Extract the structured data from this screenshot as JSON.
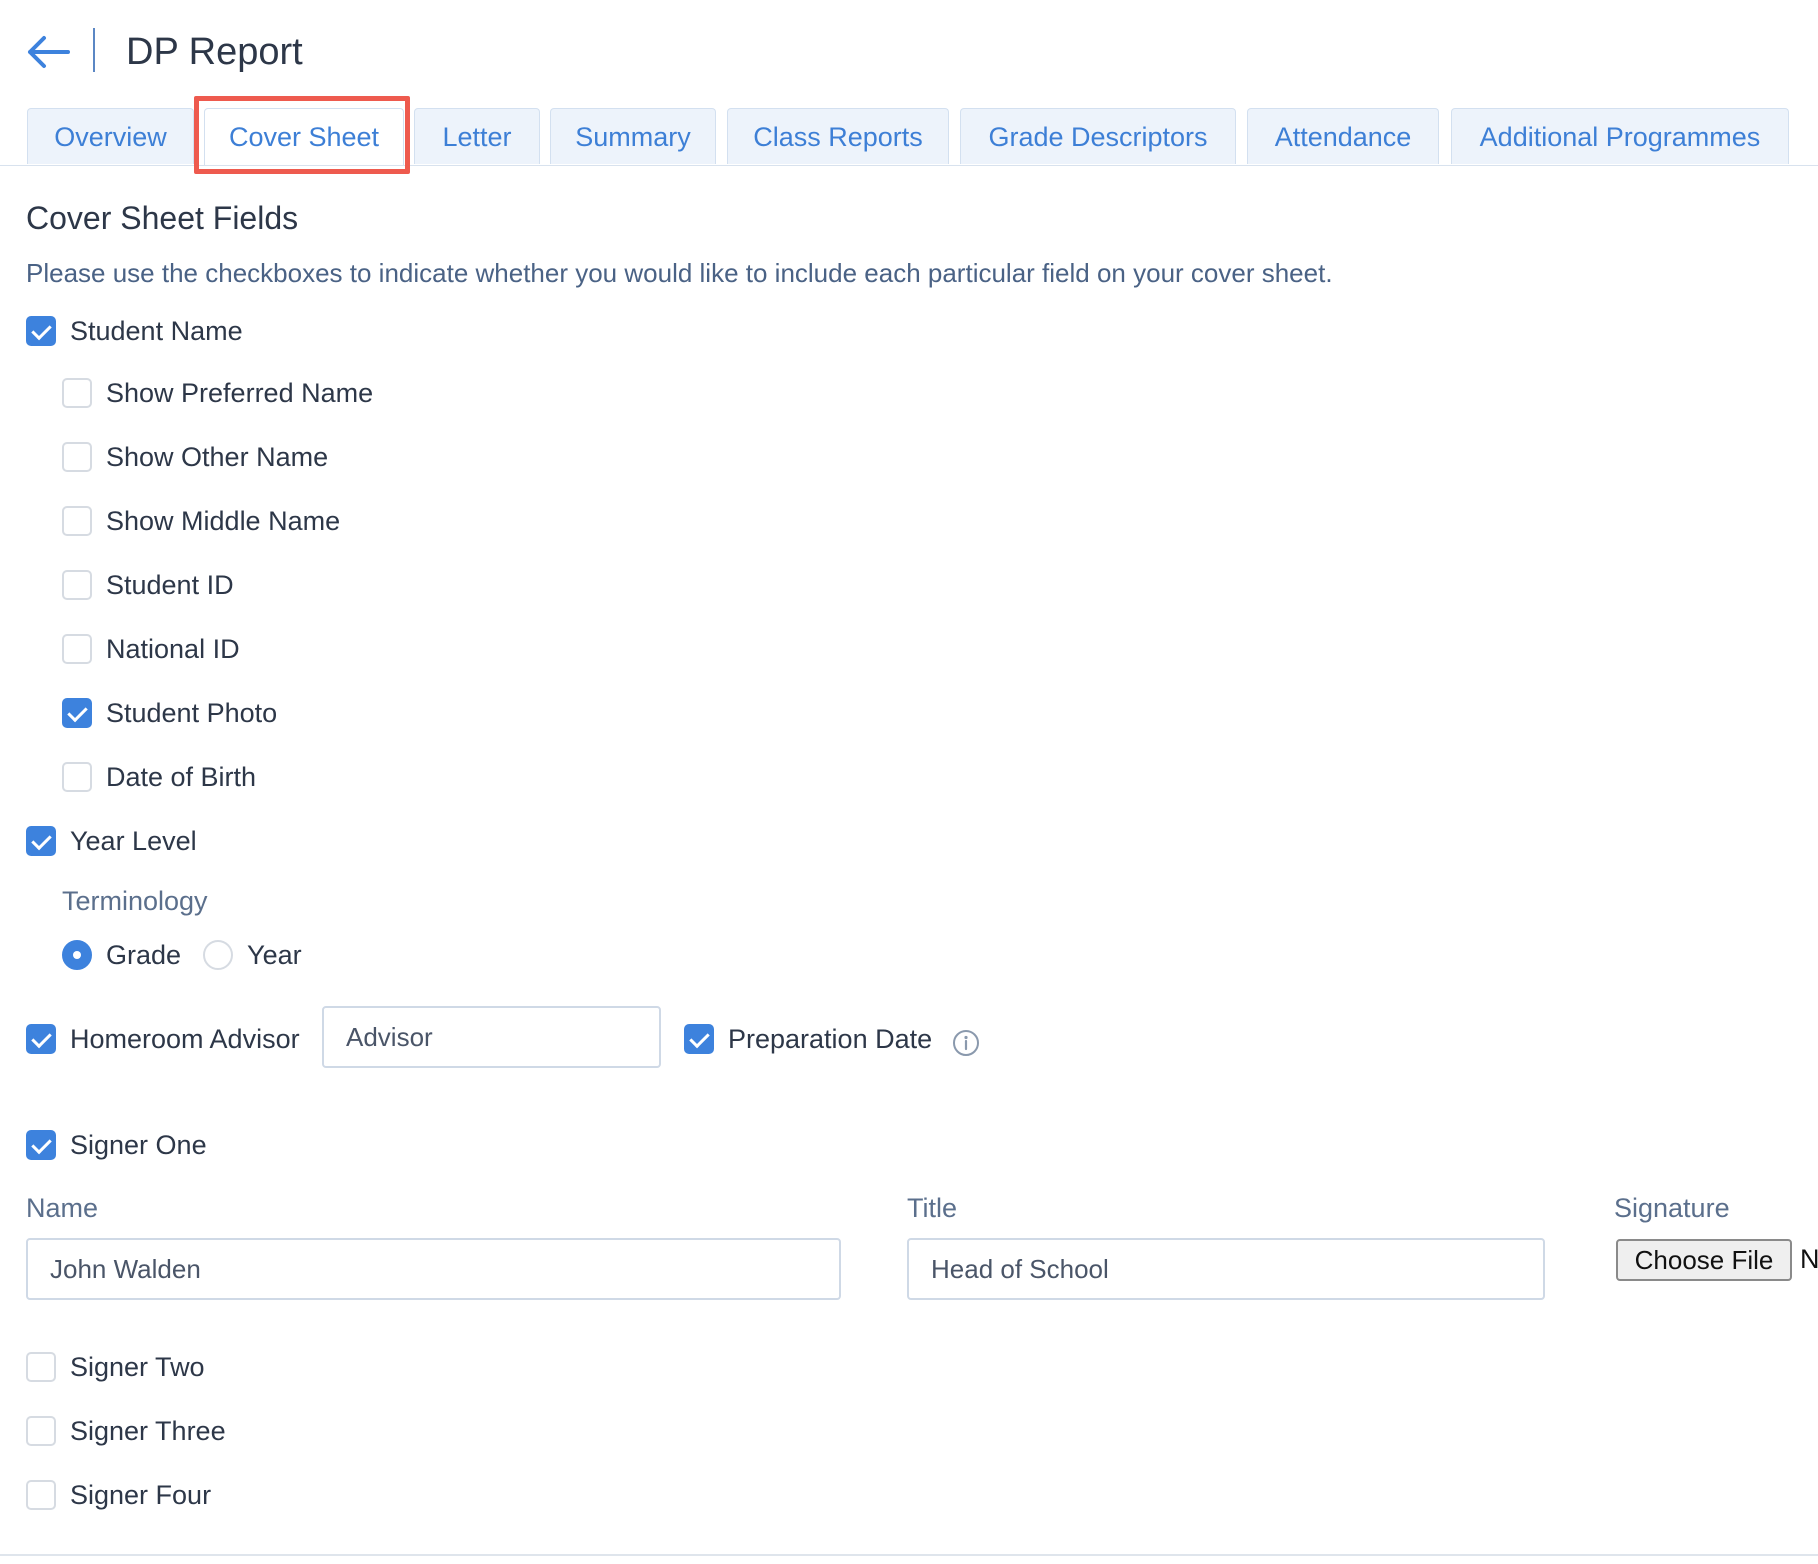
{
  "header": {
    "title": "DP Report"
  },
  "tabs": [
    {
      "label": "Overview",
      "active": false
    },
    {
      "label": "Cover Sheet",
      "active": true
    },
    {
      "label": "Letter",
      "active": false
    },
    {
      "label": "Summary",
      "active": false
    },
    {
      "label": "Class Reports",
      "active": false
    },
    {
      "label": "Grade Descriptors",
      "active": false
    },
    {
      "label": "Attendance",
      "active": false
    },
    {
      "label": "Additional Programmes",
      "active": false
    }
  ],
  "section": {
    "title": "Cover Sheet Fields",
    "description": "Please use the checkboxes to indicate whether you would like to include each particular field on your cover sheet."
  },
  "fields": {
    "student_name": {
      "label": "Student Name",
      "checked": true
    },
    "show_preferred_name": {
      "label": "Show Preferred Name",
      "checked": false
    },
    "show_other_name": {
      "label": "Show Other Name",
      "checked": false
    },
    "show_middle_name": {
      "label": "Show Middle Name",
      "checked": false
    },
    "student_id": {
      "label": "Student ID",
      "checked": false
    },
    "national_id": {
      "label": "National ID",
      "checked": false
    },
    "student_photo": {
      "label": "Student Photo",
      "checked": true
    },
    "date_of_birth": {
      "label": "Date of Birth",
      "checked": false
    },
    "year_level": {
      "label": "Year Level",
      "checked": true
    },
    "homeroom_advisor": {
      "label": "Homeroom Advisor",
      "checked": true,
      "input_value": "Advisor"
    },
    "preparation_date": {
      "label": "Preparation Date",
      "checked": true
    }
  },
  "terminology": {
    "label": "Terminology",
    "options": [
      {
        "label": "Grade",
        "selected": true
      },
      {
        "label": "Year",
        "selected": false
      }
    ]
  },
  "signers": {
    "one": {
      "label": "Signer One",
      "checked": true
    },
    "two": {
      "label": "Signer Two",
      "checked": false
    },
    "three": {
      "label": "Signer Three",
      "checked": false
    },
    "four": {
      "label": "Signer Four",
      "checked": false
    }
  },
  "signer_one_form": {
    "name_label": "Name",
    "name_value": "John Walden",
    "title_label": "Title",
    "title_value": "Head of School",
    "signature_label": "Signature",
    "file_button_label": "Choose File",
    "file_status": "N"
  },
  "colors": {
    "accent": "#3d82dd",
    "tab_text": "#3d7fd6",
    "highlight": "#ee5a4e"
  },
  "icons": {
    "back": "back-arrow-icon",
    "info": "info-icon"
  }
}
